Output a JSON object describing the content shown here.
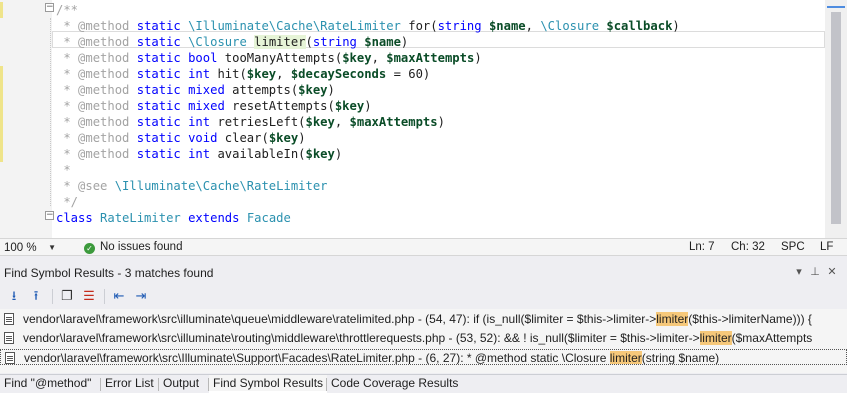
{
  "editor": {
    "lines": [
      {
        "parts": [
          [
            "c-cm",
            "/**"
          ]
        ]
      },
      {
        "parts": [
          [
            "c-cm",
            " * "
          ],
          [
            "c-tag",
            "@method"
          ],
          [
            "c-kw",
            " static "
          ],
          [
            "c-cls",
            "\\Illuminate\\Cache\\RateLimiter"
          ],
          [
            "c-fn",
            " for("
          ],
          [
            "c-kw",
            "string"
          ],
          [
            "c-fn",
            " "
          ],
          [
            "c-var",
            "$name"
          ],
          [
            "c-fn",
            ", "
          ],
          [
            "c-cls",
            "\\Closure"
          ],
          [
            "c-fn",
            " "
          ],
          [
            "c-var",
            "$callback"
          ],
          [
            "c-fn",
            ")"
          ]
        ]
      },
      {
        "parts": [
          [
            "c-cm",
            " * "
          ],
          [
            "c-tag",
            "@method"
          ],
          [
            "c-kw",
            " static "
          ],
          [
            "c-cls",
            "\\Closure"
          ],
          [
            "c-fn",
            " "
          ],
          [
            "c-hl",
            "limiter"
          ],
          [
            "c-fn",
            "("
          ],
          [
            "c-kw",
            "string"
          ],
          [
            "c-fn",
            " "
          ],
          [
            "c-var",
            "$name"
          ],
          [
            "c-fn",
            ")"
          ]
        ]
      },
      {
        "parts": [
          [
            "c-cm",
            " * "
          ],
          [
            "c-tag",
            "@method"
          ],
          [
            "c-kw",
            " static "
          ],
          [
            "c-kw",
            "bool"
          ],
          [
            "c-fn",
            " tooManyAttempts("
          ],
          [
            "c-var",
            "$key"
          ],
          [
            "c-fn",
            ", "
          ],
          [
            "c-var",
            "$maxAttempts"
          ],
          [
            "c-fn",
            ")"
          ]
        ]
      },
      {
        "parts": [
          [
            "c-cm",
            " * "
          ],
          [
            "c-tag",
            "@method"
          ],
          [
            "c-kw",
            " static "
          ],
          [
            "c-kw",
            "int"
          ],
          [
            "c-fn",
            " hit("
          ],
          [
            "c-var",
            "$key"
          ],
          [
            "c-fn",
            ", "
          ],
          [
            "c-var",
            "$decaySeconds"
          ],
          [
            "c-fn",
            " = 60)"
          ]
        ]
      },
      {
        "parts": [
          [
            "c-cm",
            " * "
          ],
          [
            "c-tag",
            "@method"
          ],
          [
            "c-kw",
            " static "
          ],
          [
            "c-kw",
            "mixed"
          ],
          [
            "c-fn",
            " attempts("
          ],
          [
            "c-var",
            "$key"
          ],
          [
            "c-fn",
            ")"
          ]
        ]
      },
      {
        "parts": [
          [
            "c-cm",
            " * "
          ],
          [
            "c-tag",
            "@method"
          ],
          [
            "c-kw",
            " static "
          ],
          [
            "c-kw",
            "mixed"
          ],
          [
            "c-fn",
            " resetAttempts("
          ],
          [
            "c-var",
            "$key"
          ],
          [
            "c-fn",
            ")"
          ]
        ]
      },
      {
        "parts": [
          [
            "c-cm",
            " * "
          ],
          [
            "c-tag",
            "@method"
          ],
          [
            "c-kw",
            " static "
          ],
          [
            "c-kw",
            "int"
          ],
          [
            "c-fn",
            " retriesLeft("
          ],
          [
            "c-var",
            "$key"
          ],
          [
            "c-fn",
            ", "
          ],
          [
            "c-var",
            "$maxAttempts"
          ],
          [
            "c-fn",
            ")"
          ]
        ]
      },
      {
        "parts": [
          [
            "c-cm",
            " * "
          ],
          [
            "c-tag",
            "@method"
          ],
          [
            "c-kw",
            " static "
          ],
          [
            "c-kw",
            "void"
          ],
          [
            "c-fn",
            " clear("
          ],
          [
            "c-var",
            "$key"
          ],
          [
            "c-fn",
            ")"
          ]
        ]
      },
      {
        "parts": [
          [
            "c-cm",
            " * "
          ],
          [
            "c-tag",
            "@method"
          ],
          [
            "c-kw",
            " static "
          ],
          [
            "c-kw",
            "int"
          ],
          [
            "c-fn",
            " availableIn("
          ],
          [
            "c-var",
            "$key"
          ],
          [
            "c-fn",
            ")"
          ]
        ]
      },
      {
        "parts": [
          [
            "c-cm",
            " *"
          ]
        ]
      },
      {
        "parts": [
          [
            "c-cm",
            " * "
          ],
          [
            "c-tag",
            "@see"
          ],
          [
            "c-fn",
            " "
          ],
          [
            "c-cls",
            "\\Illuminate\\Cache\\RateLimiter"
          ]
        ]
      },
      {
        "parts": [
          [
            "c-cm",
            " */"
          ]
        ]
      },
      {
        "parts": [
          [
            "c-kw",
            "class"
          ],
          [
            "c-fn",
            " "
          ],
          [
            "c-cls",
            "RateLimiter"
          ],
          [
            "c-fn",
            " "
          ],
          [
            "c-kw",
            "extends"
          ],
          [
            "c-fn",
            " "
          ],
          [
            "c-cls",
            "Facade"
          ]
        ]
      }
    ]
  },
  "status": {
    "zoom": "100 %",
    "issues": "No issues found",
    "ln": "Ln: 7",
    "ch": "Ch: 32",
    "ws": "SPC",
    "eol": "LF"
  },
  "find_panel": {
    "title": "Find Symbol Results - 3 matches found",
    "results": [
      {
        "pre": "vendor\\laravel\\framework\\src\\illuminate\\queue\\middleware\\ratelimited.php - (54, 47): if (is_null($limiter = $this->limiter->",
        "hit": "limiter",
        "post": "($this->limiterName))) {",
        "selected": false
      },
      {
        "pre": "vendor\\laravel\\framework\\src\\illuminate\\routing\\middleware\\throttlerequests.php - (53, 52): && ! is_null($limiter = $this->limiter->",
        "hit": "limiter",
        "post": "($maxAttempts",
        "selected": false
      },
      {
        "pre": "vendor\\laravel\\framework\\src\\Illuminate\\Support\\Facades\\RateLimiter.php - (6, 27): * @method static \\Closure ",
        "hit": "limiter",
        "post": "(string $name)",
        "selected": true
      }
    ]
  },
  "tabs": [
    "Find \"@method\"",
    "Error List",
    "Output",
    "Find Symbol Results",
    "Code Coverage Results"
  ],
  "active_tab": 3,
  "colors": {
    "hit": "#f6c87a",
    "keyword": "#0000ff",
    "type": "#2b91af",
    "variable": "#0a4c27"
  }
}
